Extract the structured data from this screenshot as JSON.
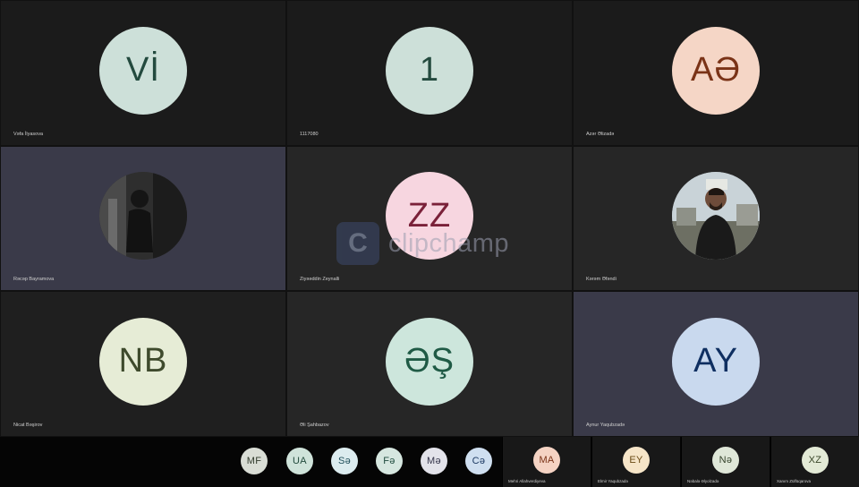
{
  "tiles": [
    {
      "initials": "Vİ",
      "name": "Vəfa İlyasova",
      "bg": "#1b1b1b",
      "avatar_bg": "#cde0d9",
      "avatar_fg": "#234a3e",
      "photo": false
    },
    {
      "initials": "1",
      "name": "1117080",
      "bg": "#1b1b1b",
      "avatar_bg": "#cde0d9",
      "avatar_fg": "#234a3e",
      "photo": false
    },
    {
      "initials": "AƏ",
      "name": "Azər Əlizadə",
      "bg": "#1b1b1b",
      "avatar_bg": "#f5d6c6",
      "avatar_fg": "#7a3317",
      "photo": false
    },
    {
      "initials": "",
      "name": "Rəcəp Bayramova",
      "bg": "#3a3a49",
      "avatar_bg": "#3a3a3a",
      "avatar_fg": "#ffffff",
      "photo": true,
      "photo_icon": "person-photo-dark"
    },
    {
      "initials": "ZZ",
      "name": "Ziyəəddin Zeynalli",
      "bg": "#262626",
      "avatar_bg": "#f7d6e0",
      "avatar_fg": "#7a2139",
      "photo": false
    },
    {
      "initials": "",
      "name": "Kərəm Əfəndi",
      "bg": "#262626",
      "avatar_bg": "#9ea6aa",
      "avatar_fg": "#ffffff",
      "photo": true,
      "photo_icon": "person-photo-outdoor"
    },
    {
      "initials": "NB",
      "name": "Nicat Bəşirov",
      "bg": "#1f1f1f",
      "avatar_bg": "#e6ecd6",
      "avatar_fg": "#3e4a2c",
      "photo": false
    },
    {
      "initials": "ƏŞ",
      "name": "Əli Şahbazov",
      "bg": "#262626",
      "avatar_bg": "#cde6dc",
      "avatar_fg": "#1f5a45",
      "photo": false
    },
    {
      "initials": "AY",
      "name": "Aynur Yaqubzadə",
      "bg": "#3a3a49",
      "avatar_bg": "#c9d9ee",
      "avatar_fg": "#0f2f61",
      "photo": false
    }
  ],
  "watermark": {
    "logo": "C",
    "text": "clipchamp"
  },
  "bottom_avatars": [
    {
      "initials": "MF",
      "bg": "#d9ddd5",
      "fg": "#303a2c"
    },
    {
      "initials": "UA",
      "bg": "#cfe3da",
      "fg": "#224a3c"
    },
    {
      "initials": "Sə",
      "bg": "#dcecef",
      "fg": "#1f4e5a"
    },
    {
      "initials": "Fə",
      "bg": "#d6e7e0",
      "fg": "#1f4b3e"
    },
    {
      "initials": "Mə",
      "bg": "#e3e3ea",
      "fg": "#34344a"
    },
    {
      "initials": "Cə",
      "bg": "#cfdff0",
      "fg": "#1d3a63"
    }
  ],
  "bottom_named": [
    {
      "initials": "MA",
      "name": "Mehri Allahverdiyeva",
      "bg": "#f5d3c3",
      "fg": "#7a3317"
    },
    {
      "initials": "EY",
      "name": "Elmir Yaqubzadə",
      "bg": "#f6e5c8",
      "fg": "#6a4a14"
    },
    {
      "initials": "Nə",
      "name": "Nəbalə Əlyolzadə",
      "bg": "#dfe7d8",
      "fg": "#34422a"
    },
    {
      "initials": "XZ",
      "name": "Xanım Zülfüqarova",
      "bg": "#e3ead6",
      "fg": "#3a4628"
    }
  ]
}
